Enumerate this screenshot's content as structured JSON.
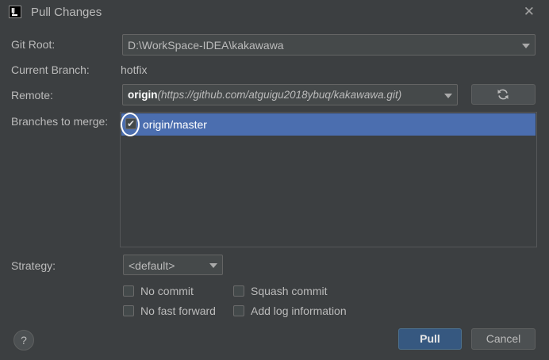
{
  "window": {
    "title": "Pull Changes",
    "app_icon": "intellij-idea-icon",
    "close_icon": "close-icon"
  },
  "form": {
    "git_root_label": "Git Root:",
    "git_root_value": "D:\\WorkSpace-IDEA\\kakawawa",
    "current_branch_label": "Current Branch:",
    "current_branch_value": "hotfix",
    "remote_label": "Remote:",
    "remote_name": "origin",
    "remote_url": "(https://github.com/atguigu2018ybuq/kakawawa.git)",
    "refresh_icon": "refresh-icon",
    "branches_label": "Branches to merge:",
    "branches": [
      {
        "name": "origin/master",
        "checked": true
      }
    ],
    "strategy_label": "Strategy:",
    "strategy_value": "<default>"
  },
  "options": {
    "no_commit": {
      "label": "No commit",
      "checked": false
    },
    "squash_commit": {
      "label": "Squash commit",
      "checked": false
    },
    "no_fast_forward": {
      "label": "No fast forward",
      "checked": false
    },
    "add_log_information": {
      "label": "Add log information",
      "checked": false
    }
  },
  "buttons": {
    "help": "?",
    "pull": "Pull",
    "cancel": "Cancel"
  }
}
